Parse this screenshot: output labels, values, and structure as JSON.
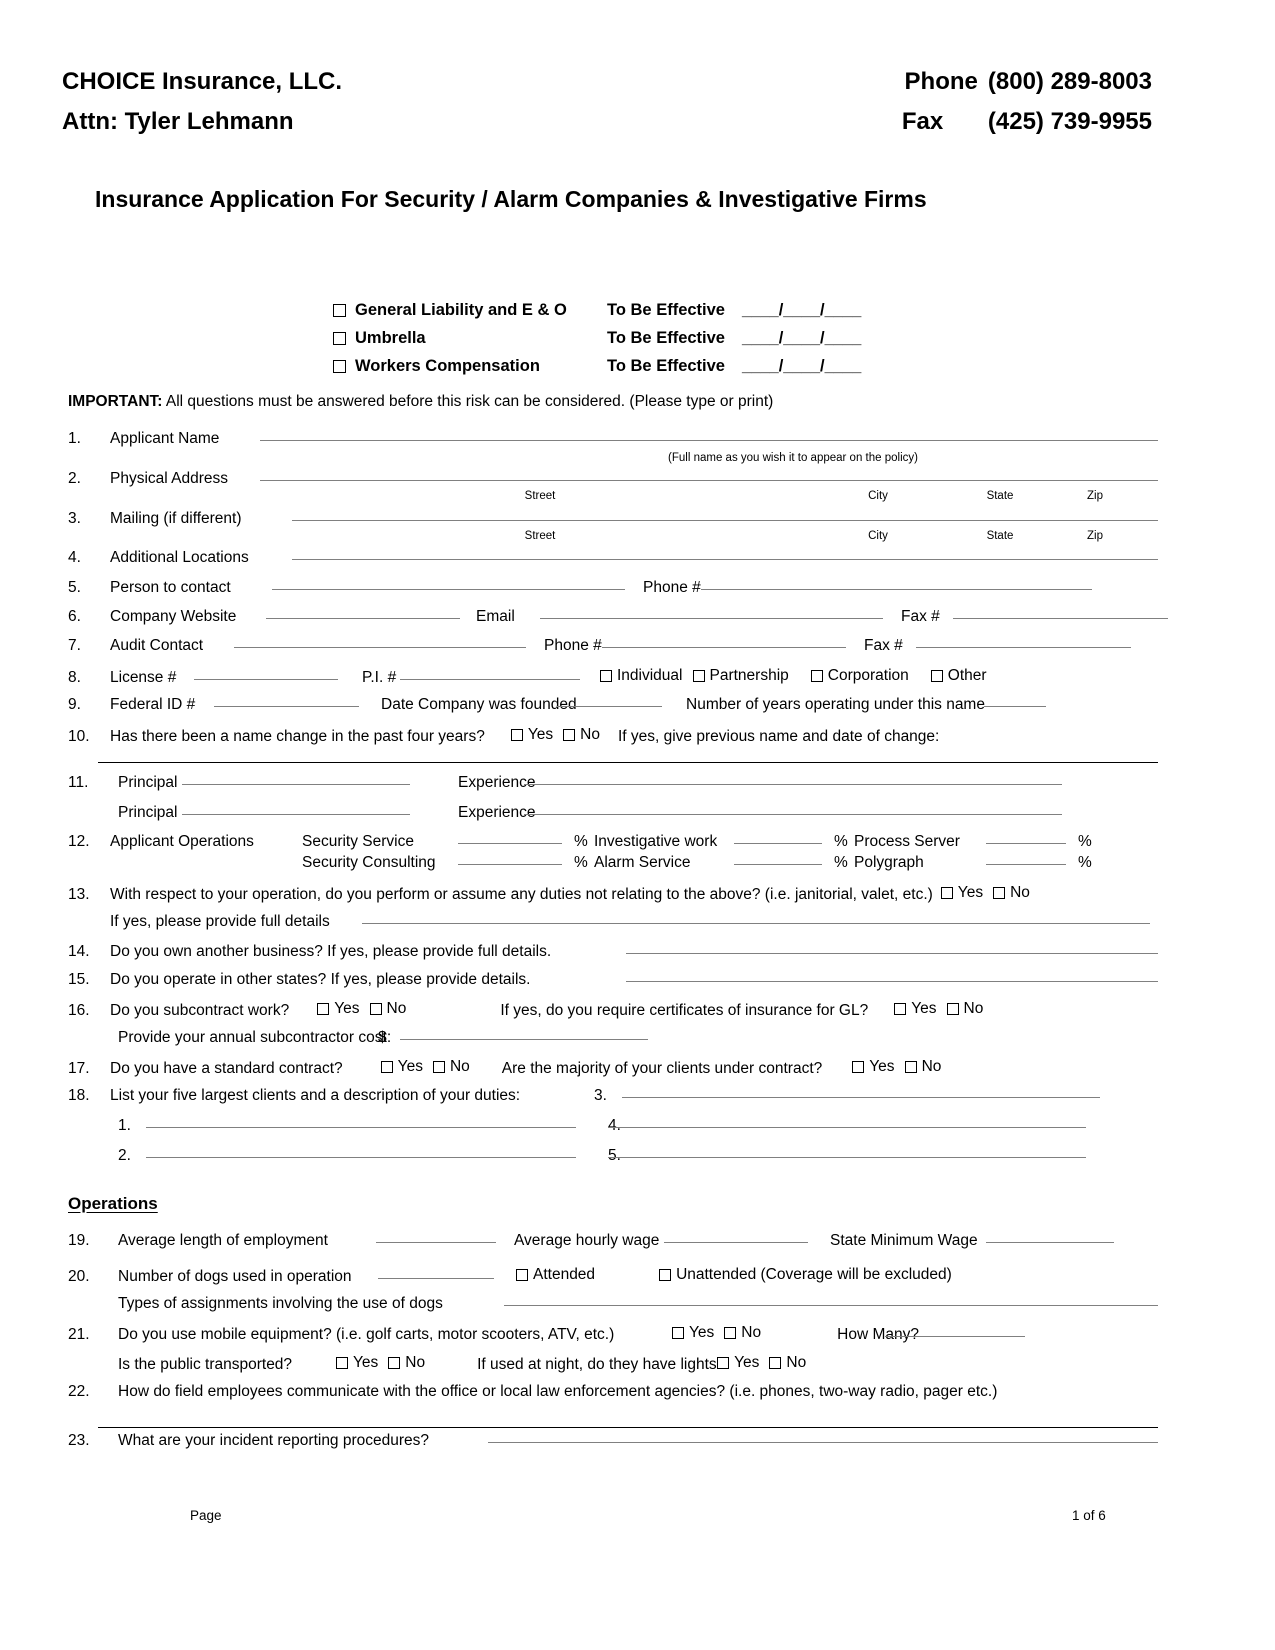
{
  "header": {
    "company": "CHOICE Insurance, LLC.",
    "attn": "Attn: Tyler Lehmann",
    "phone_label": "Phone",
    "phone_number": "(800) 289-8003",
    "fax_label": "Fax",
    "fax_number": "(425) 739-9955"
  },
  "document_title": "Insurance Application For Security / Alarm Companies & Investigative Firms",
  "coverage": {
    "effective_label": "To Be Effective",
    "date_blank": "____/____/____",
    "options": [
      {
        "label": "General Liability and E & O"
      },
      {
        "label": "Umbrella"
      },
      {
        "label": "Workers Compensation"
      }
    ]
  },
  "important": {
    "bold": "IMPORTANT:",
    "text": "All questions must be answered before this risk can be considered.  (Please type or print)"
  },
  "questions": {
    "q1": {
      "num": "1.",
      "label": "Applicant Name",
      "caption": "(Full name as you wish it to appear on the policy)"
    },
    "q2": {
      "num": "2.",
      "label": "Physical Address"
    },
    "q3": {
      "num": "3.",
      "label": "Mailing (if different)"
    },
    "address_captions": {
      "street": "Street",
      "city": "City",
      "state": "State",
      "zip": "Zip"
    },
    "q4": {
      "num": "4.",
      "label": "Additional Locations"
    },
    "q5": {
      "num": "5.",
      "label": "Person to contact",
      "phone_label": "Phone #"
    },
    "q6": {
      "num": "6.",
      "label": "Company Website",
      "email_label": "Email",
      "fax_label": "Fax #"
    },
    "q7": {
      "num": "7.",
      "label": "Audit Contact",
      "phone_label": "Phone #",
      "fax_label": "Fax #"
    },
    "q8": {
      "num": "8.",
      "label": "License #",
      "pi_label": "P.I. #",
      "entity_types": [
        "Individual",
        "Partnership",
        "Corporation",
        "Other"
      ]
    },
    "q9": {
      "num": "9.",
      "label": "Federal ID #",
      "founded_label": "Date Company was founded",
      "years_label": "Number of years operating under this name"
    },
    "q10": {
      "num": "10.",
      "label": "Has there been a name change in the past four years?",
      "yes": "Yes",
      "no": "No",
      "followup": "If yes, give previous name and date of change:"
    },
    "q11": {
      "num": "11.",
      "principal_label": "Principal",
      "experience_label": "Experience",
      "rows": 2
    },
    "q12": {
      "num": "12.",
      "label": "Applicant Operations",
      "percent_symbol": "%",
      "items": [
        [
          "Security Service",
          "Investigative work",
          "Process Server"
        ],
        [
          "Security Consulting",
          "Alarm Service",
          "Polygraph"
        ]
      ]
    },
    "q13": {
      "num": "13.",
      "label": "With respect to your operation, do you perform or assume any duties not relating to the above? (i.e. janitorial, valet, etc.)",
      "yes": "Yes",
      "no": "No",
      "details_label": "If yes, please provide full details"
    },
    "q14": {
      "num": "14.",
      "label": "Do you own another business?  If yes, please provide full details."
    },
    "q15": {
      "num": "15.",
      "label": "Do you operate in other states? If yes, please provide details."
    },
    "q16": {
      "num": "16.",
      "label": "Do you subcontract work?",
      "yes": "Yes",
      "no": "No",
      "second_label": "If yes, do you require certificates of insurance for GL?",
      "cost_label": "Provide your annual subcontractor cost:",
      "currency": "$"
    },
    "q17": {
      "num": "17.",
      "label": "Do you have a standard contract?",
      "yes": "Yes",
      "no": "No",
      "second_label": "Are the majority of your clients under contract?"
    },
    "q18": {
      "num": "18.",
      "label": "List your five largest clients and a description of your duties:",
      "items": [
        "1.",
        "2.",
        "3.",
        "4.",
        "5."
      ]
    }
  },
  "operations": {
    "heading": "Operations",
    "q19": {
      "num": "19.",
      "label": "Average length of employment",
      "wage_label": "Average hourly wage",
      "min_wage_label": "State Minimum Wage"
    },
    "q20": {
      "num": "20.",
      "label": "Number of dogs used in operation",
      "attended": "Attended",
      "unattended": "Unattended (Coverage will be excluded)",
      "types_label": "Types of assignments involving the use of dogs"
    },
    "q21": {
      "num": "21.",
      "label": "Do you use mobile equipment? (i.e. golf carts, motor scooters, ATV, etc.)",
      "yes": "Yes",
      "no": "No",
      "how_many": "How Many?",
      "public_label": "Is the public transported?",
      "lights_label": "If used at night, do they have lights?"
    },
    "q22": {
      "num": "22.",
      "label": "How do field employees communicate with the office or local law enforcement agencies? (i.e. phones, two-way radio, pager etc.)"
    },
    "q23": {
      "num": "23.",
      "label": "What are your incident reporting procedures?"
    }
  },
  "footer": {
    "left": "Page",
    "right": "1 of 6"
  }
}
